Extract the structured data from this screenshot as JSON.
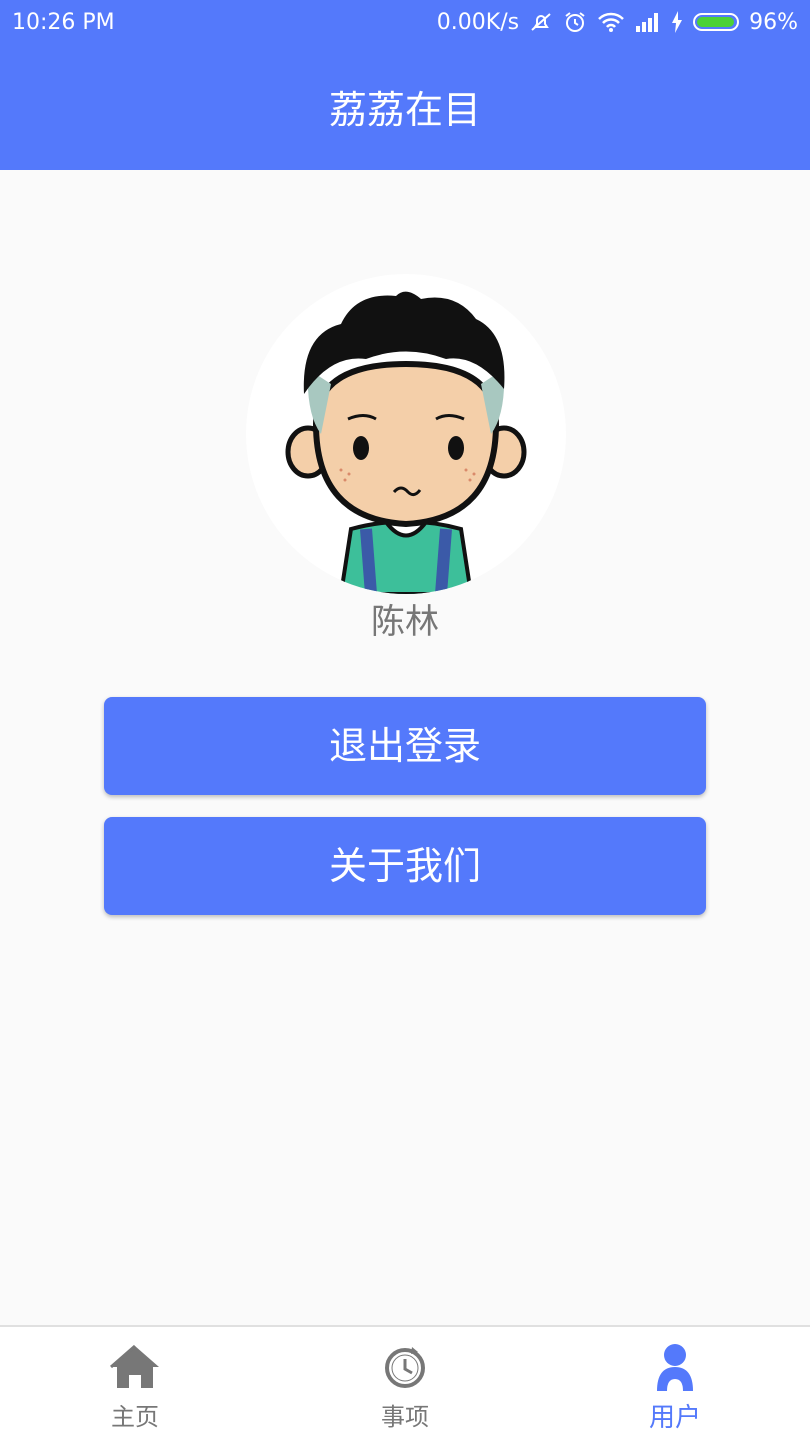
{
  "status_bar": {
    "time": "10:26  PM",
    "net_speed": "0.00K/s",
    "battery_percent": "96%",
    "battery_level": 0.96,
    "icons": [
      "mute-icon",
      "alarm-icon",
      "wifi-icon",
      "signal-icon",
      "charging-icon",
      "battery-icon"
    ]
  },
  "app_bar": {
    "title": "荔荔在目"
  },
  "profile": {
    "avatar_icon": "cartoon-boy-avatar",
    "name": "陈林"
  },
  "actions": {
    "logout_label": "退出登录",
    "about_label": "关于我们"
  },
  "bottom_nav": {
    "items": [
      {
        "label": "主页",
        "icon": "home-icon",
        "active": false
      },
      {
        "label": "事项",
        "icon": "clock-icon",
        "active": false
      },
      {
        "label": "用户",
        "icon": "user-icon",
        "active": true
      }
    ]
  },
  "colors": {
    "primary": "#5479fb",
    "background": "#fafafa",
    "inactive": "#777777",
    "battery": "#4cd137"
  }
}
